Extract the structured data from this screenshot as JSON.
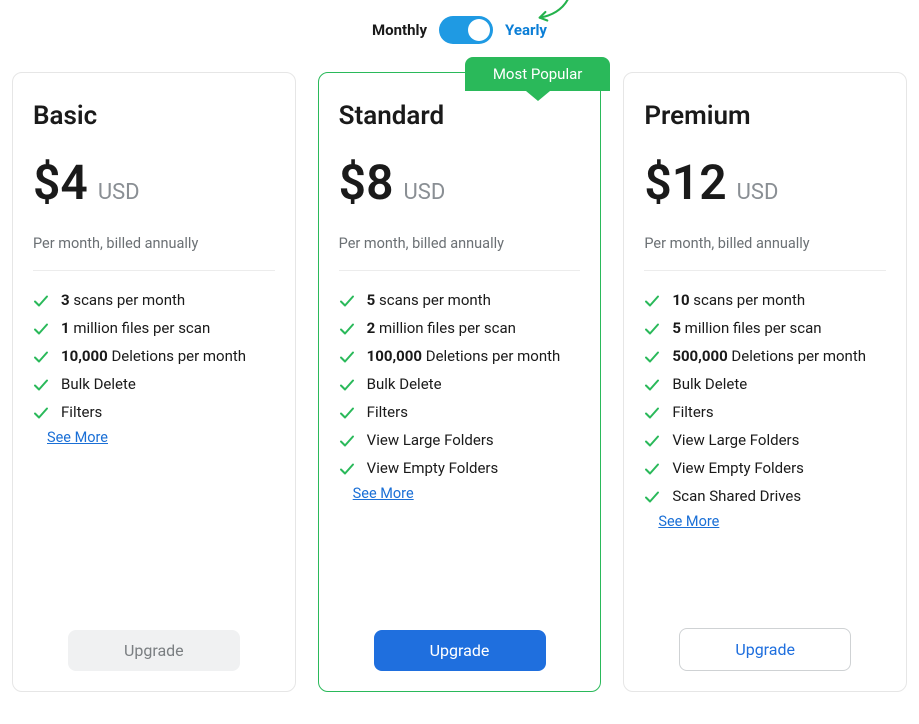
{
  "toggle": {
    "left_label": "Monthly",
    "right_label": "Yearly",
    "active": "Yearly"
  },
  "ribbon": "Most Popular",
  "currency_code": "USD",
  "billing_note": "Per month, billed annually",
  "see_more": "See More",
  "plans": [
    {
      "name": "Basic",
      "price": "$4",
      "features": [
        {
          "bold": "3",
          "rest": " scans per month"
        },
        {
          "bold": "1",
          "rest": " million files per scan"
        },
        {
          "bold": "10,000",
          "rest": " Deletions per month"
        },
        {
          "bold": "",
          "rest": "Bulk Delete"
        },
        {
          "bold": "",
          "rest": "Filters"
        }
      ],
      "button_label": "Upgrade",
      "button_style": "disabled"
    },
    {
      "name": "Standard",
      "price": "$8",
      "featured": true,
      "features": [
        {
          "bold": "5",
          "rest": " scans per month"
        },
        {
          "bold": "2",
          "rest": " million files per scan"
        },
        {
          "bold": "100,000",
          "rest": " Deletions per month"
        },
        {
          "bold": "",
          "rest": "Bulk Delete"
        },
        {
          "bold": "",
          "rest": "Filters"
        },
        {
          "bold": "",
          "rest": "View Large Folders"
        },
        {
          "bold": "",
          "rest": "View Empty Folders"
        }
      ],
      "button_label": "Upgrade",
      "button_style": "primary"
    },
    {
      "name": "Premium",
      "price": "$12",
      "features": [
        {
          "bold": "10",
          "rest": " scans per month"
        },
        {
          "bold": "5",
          "rest": " million files per scan"
        },
        {
          "bold": "500,000",
          "rest": " Deletions per month"
        },
        {
          "bold": "",
          "rest": "Bulk Delete"
        },
        {
          "bold": "",
          "rest": "Filters"
        },
        {
          "bold": "",
          "rest": "View Large Folders"
        },
        {
          "bold": "",
          "rest": "View Empty Folders"
        },
        {
          "bold": "",
          "rest": "Scan Shared Drives"
        }
      ],
      "button_label": "Upgrade",
      "button_style": "outline"
    }
  ]
}
